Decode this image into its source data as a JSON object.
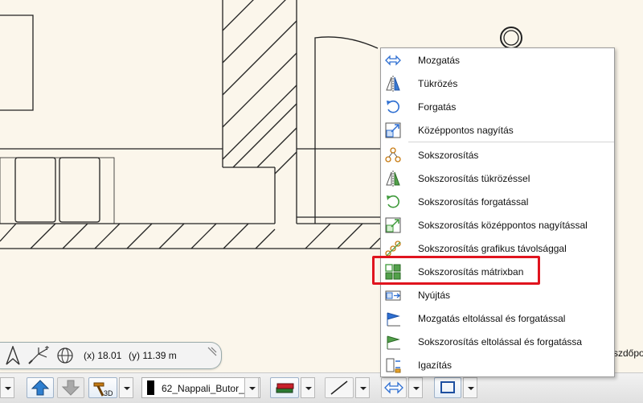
{
  "menu": {
    "items": [
      {
        "label": "Mozgatás",
        "icon": "move-arrows-icon"
      },
      {
        "label": "Tükrözés",
        "icon": "mirror-icon"
      },
      {
        "label": "Forgatás",
        "icon": "rotate-icon"
      },
      {
        "label": "Középpontos nagyítás",
        "icon": "center-scale-icon"
      },
      {
        "label": "Sokszorosítás",
        "icon": "multiply-icon"
      },
      {
        "label": "Sokszorosítás tükrözéssel",
        "icon": "multiply-mirror-icon"
      },
      {
        "label": "Sokszorosítás forgatással",
        "icon": "multiply-rotate-icon"
      },
      {
        "label": "Sokszorosítás középpontos nagyítással",
        "icon": "multiply-scale-icon"
      },
      {
        "label": "Sokszorosítás grafikus távolsággal",
        "icon": "multiply-distance-icon"
      },
      {
        "label": "Sokszorosítás mátrixban",
        "icon": "matrix-icon"
      },
      {
        "label": "Nyújtás",
        "icon": "stretch-icon"
      },
      {
        "label": "Mozgatás eltolással és forgatással",
        "icon": "move-offset-rotate-icon"
      },
      {
        "label": "Sokszorosítás eltolással és forgatássa",
        "icon": "multiply-offset-rotate-icon"
      },
      {
        "label": "Igazítás",
        "icon": "align-icon"
      }
    ],
    "highlighted": "Sokszorosítás mátrixban"
  },
  "coords": {
    "x": "(x) 18.01",
    "y": "(y) 11.39 m"
  },
  "toolbar": {
    "layer_name": "62_Nappali_Butor_",
    "view_3d_label": "3D"
  },
  "right_label": "szdőpon",
  "colors": {
    "canvas": "#fbf6eb",
    "highlight": "#e0141e",
    "accent": "#2e6fd2"
  }
}
